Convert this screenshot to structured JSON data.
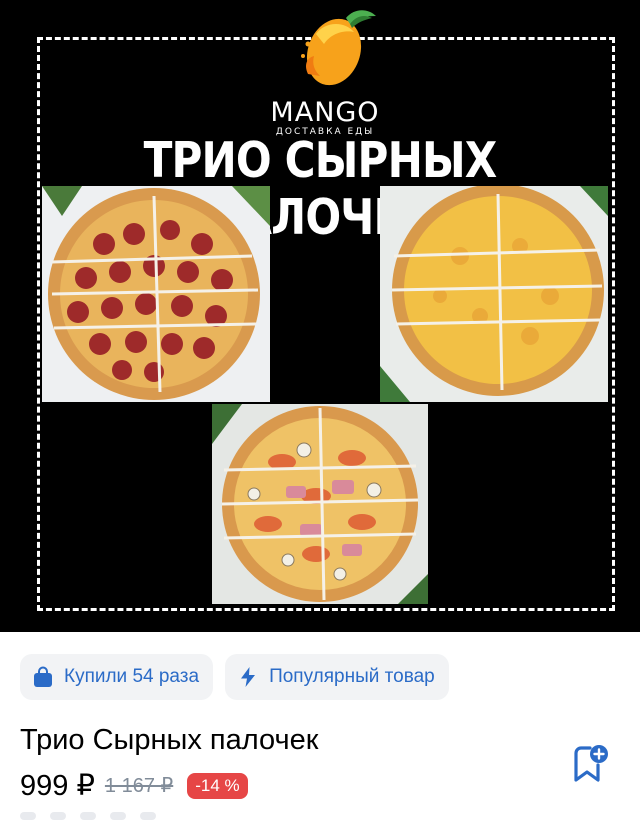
{
  "banner": {
    "brand": "MANGO",
    "brand_sub": "ДОСТАВКА ЕДЫ",
    "headline": "ТРИО СЫРНЫХ ПАЛОЧЕК",
    "photos": [
      "pepperoni-pizza",
      "cheese-pizza",
      "ham-mushroom-tomato-pizza"
    ]
  },
  "badges": [
    {
      "icon": "shopping-bag-icon",
      "label": "Купили 54 раза"
    },
    {
      "icon": "lightning-icon",
      "label": "Популярный товар"
    }
  ],
  "product": {
    "title": "Трио Сырных палочек",
    "price": "999 ₽",
    "old_price": "1 167 ₽",
    "discount": "-14 %",
    "wishlist_icon": "bookmark-add-icon"
  },
  "colors": {
    "accent": "#2b6bc7",
    "discount": "#e64646",
    "badge_bg": "#f2f3f5",
    "muted": "#818c99"
  }
}
